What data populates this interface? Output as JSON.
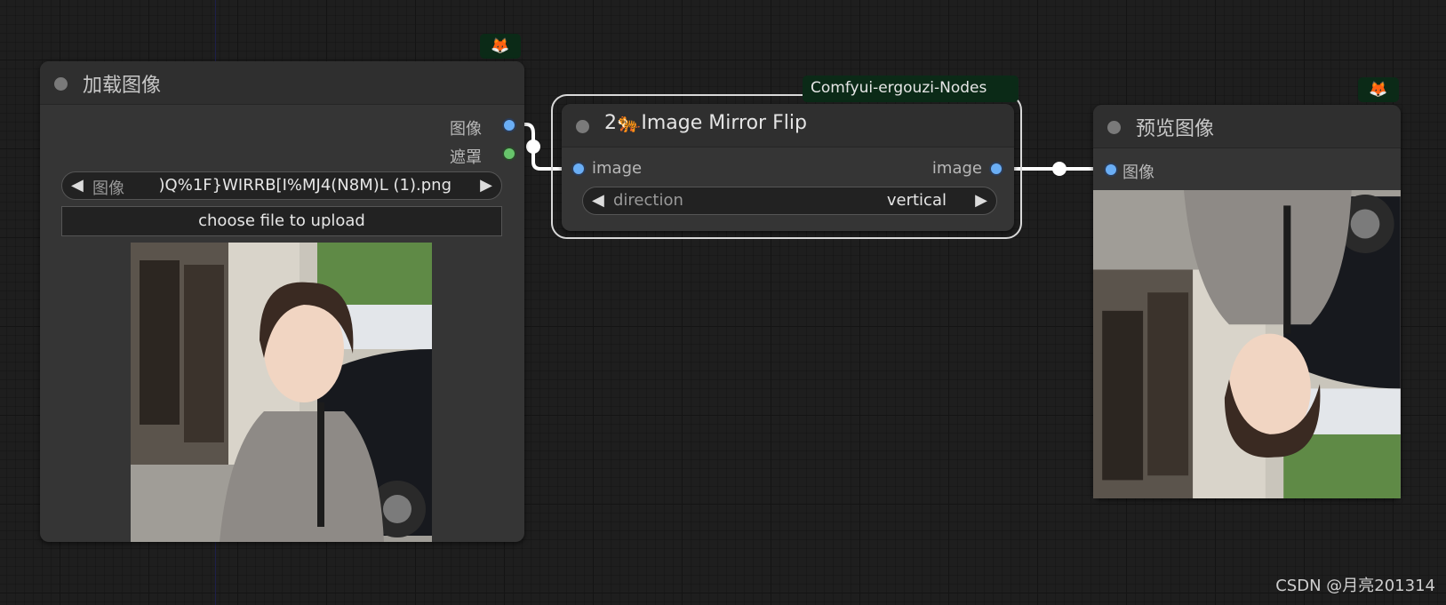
{
  "canvas": {
    "watermark": "CSDN @月亮201314"
  },
  "load_image_node": {
    "title": "加载图像",
    "badge_icon": "fox-icon",
    "outputs": [
      {
        "label": "图像",
        "color": "#6aaef5"
      },
      {
        "label": "遮罩",
        "color": "#67c56b"
      }
    ],
    "image_combo": {
      "name": "图像",
      "value": ")Q%1F}WIRRB[I%MJ4(N8M)L (1).png"
    },
    "upload_button": "choose file to upload"
  },
  "mirror_flip_node": {
    "badge": "Comfyui-ergouzi-Nodes",
    "title": "2🐅Image Mirror Flip",
    "input_label": "image",
    "output_label": "image",
    "direction_combo": {
      "name": "direction",
      "value": "vertical"
    }
  },
  "preview_node": {
    "title": "预览图像",
    "badge_icon": "fox-icon",
    "input_label": "图像"
  }
}
